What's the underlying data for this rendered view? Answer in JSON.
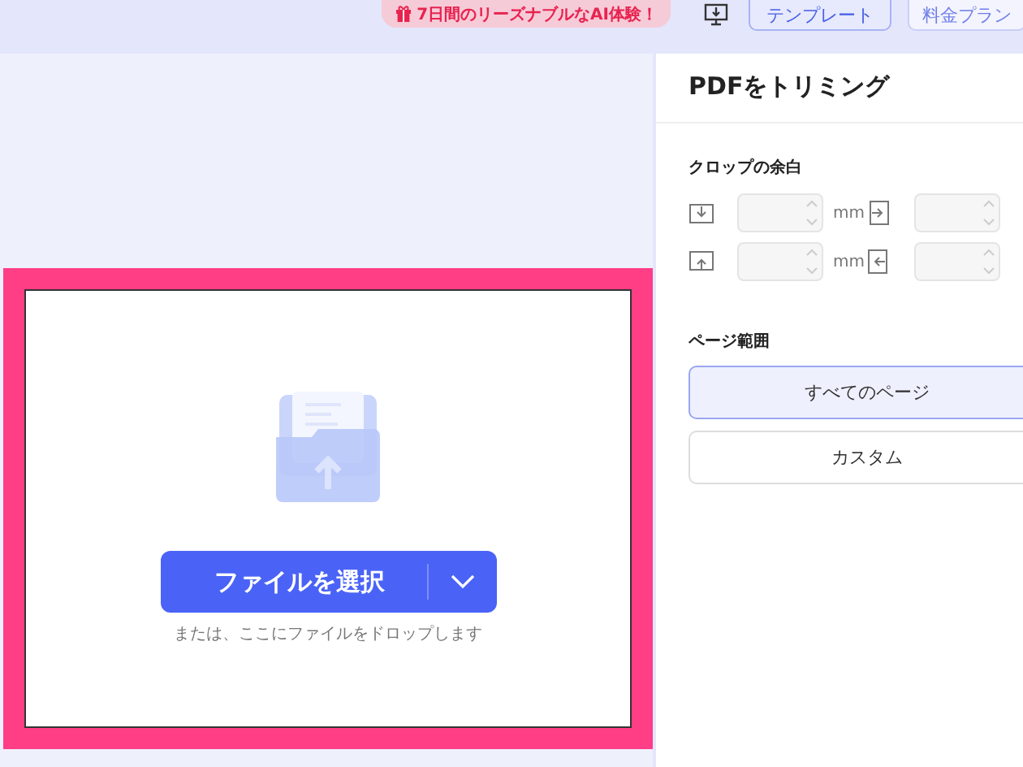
{
  "top_bar": {
    "promo": "7日間のリーズナブルなAI体験！",
    "buttons": [
      {
        "label": "テンプレート"
      },
      {
        "label": "料金プラン"
      }
    ]
  },
  "upload": {
    "button": "ファイルを選択",
    "hint": "または、ここにファイルをドロップします"
  },
  "panel": {
    "title": "PDFをトリミング",
    "margins": {
      "label": "クロップの余白",
      "fields": [
        {
          "kind": "top",
          "unit": "mm",
          "disabled": true
        },
        {
          "kind": "right",
          "disabled": true
        },
        {
          "kind": "bottom",
          "unit": "mm",
          "disabled": true
        },
        {
          "kind": "left",
          "disabled": true
        }
      ]
    },
    "page_range": {
      "label": "ページ範囲",
      "options": [
        {
          "label": "すべてのページ",
          "selected": true
        },
        {
          "label": "カスタム",
          "selected": false
        }
      ]
    }
  }
}
